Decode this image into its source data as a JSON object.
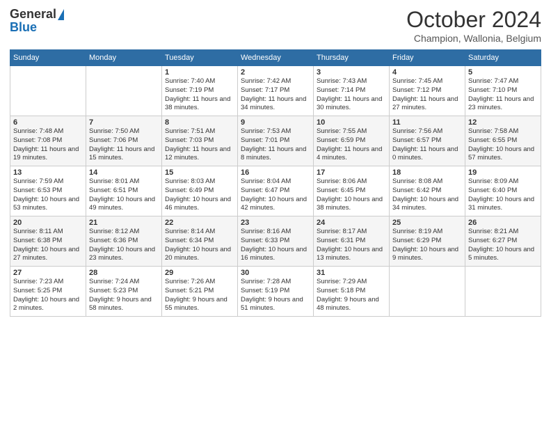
{
  "header": {
    "logo_general": "General",
    "logo_blue": "Blue",
    "title": "October 2024",
    "subtitle": "Champion, Wallonia, Belgium"
  },
  "days_of_week": [
    "Sunday",
    "Monday",
    "Tuesday",
    "Wednesday",
    "Thursday",
    "Friday",
    "Saturday"
  ],
  "weeks": [
    [
      {
        "day": "",
        "info": ""
      },
      {
        "day": "",
        "info": ""
      },
      {
        "day": "1",
        "info": "Sunrise: 7:40 AM\nSunset: 7:19 PM\nDaylight: 11 hours and 38 minutes."
      },
      {
        "day": "2",
        "info": "Sunrise: 7:42 AM\nSunset: 7:17 PM\nDaylight: 11 hours and 34 minutes."
      },
      {
        "day": "3",
        "info": "Sunrise: 7:43 AM\nSunset: 7:14 PM\nDaylight: 11 hours and 30 minutes."
      },
      {
        "day": "4",
        "info": "Sunrise: 7:45 AM\nSunset: 7:12 PM\nDaylight: 11 hours and 27 minutes."
      },
      {
        "day": "5",
        "info": "Sunrise: 7:47 AM\nSunset: 7:10 PM\nDaylight: 11 hours and 23 minutes."
      }
    ],
    [
      {
        "day": "6",
        "info": "Sunrise: 7:48 AM\nSunset: 7:08 PM\nDaylight: 11 hours and 19 minutes."
      },
      {
        "day": "7",
        "info": "Sunrise: 7:50 AM\nSunset: 7:06 PM\nDaylight: 11 hours and 15 minutes."
      },
      {
        "day": "8",
        "info": "Sunrise: 7:51 AM\nSunset: 7:03 PM\nDaylight: 11 hours and 12 minutes."
      },
      {
        "day": "9",
        "info": "Sunrise: 7:53 AM\nSunset: 7:01 PM\nDaylight: 11 hours and 8 minutes."
      },
      {
        "day": "10",
        "info": "Sunrise: 7:55 AM\nSunset: 6:59 PM\nDaylight: 11 hours and 4 minutes."
      },
      {
        "day": "11",
        "info": "Sunrise: 7:56 AM\nSunset: 6:57 PM\nDaylight: 11 hours and 0 minutes."
      },
      {
        "day": "12",
        "info": "Sunrise: 7:58 AM\nSunset: 6:55 PM\nDaylight: 10 hours and 57 minutes."
      }
    ],
    [
      {
        "day": "13",
        "info": "Sunrise: 7:59 AM\nSunset: 6:53 PM\nDaylight: 10 hours and 53 minutes."
      },
      {
        "day": "14",
        "info": "Sunrise: 8:01 AM\nSunset: 6:51 PM\nDaylight: 10 hours and 49 minutes."
      },
      {
        "day": "15",
        "info": "Sunrise: 8:03 AM\nSunset: 6:49 PM\nDaylight: 10 hours and 46 minutes."
      },
      {
        "day": "16",
        "info": "Sunrise: 8:04 AM\nSunset: 6:47 PM\nDaylight: 10 hours and 42 minutes."
      },
      {
        "day": "17",
        "info": "Sunrise: 8:06 AM\nSunset: 6:45 PM\nDaylight: 10 hours and 38 minutes."
      },
      {
        "day": "18",
        "info": "Sunrise: 8:08 AM\nSunset: 6:42 PM\nDaylight: 10 hours and 34 minutes."
      },
      {
        "day": "19",
        "info": "Sunrise: 8:09 AM\nSunset: 6:40 PM\nDaylight: 10 hours and 31 minutes."
      }
    ],
    [
      {
        "day": "20",
        "info": "Sunrise: 8:11 AM\nSunset: 6:38 PM\nDaylight: 10 hours and 27 minutes."
      },
      {
        "day": "21",
        "info": "Sunrise: 8:12 AM\nSunset: 6:36 PM\nDaylight: 10 hours and 23 minutes."
      },
      {
        "day": "22",
        "info": "Sunrise: 8:14 AM\nSunset: 6:34 PM\nDaylight: 10 hours and 20 minutes."
      },
      {
        "day": "23",
        "info": "Sunrise: 8:16 AM\nSunset: 6:33 PM\nDaylight: 10 hours and 16 minutes."
      },
      {
        "day": "24",
        "info": "Sunrise: 8:17 AM\nSunset: 6:31 PM\nDaylight: 10 hours and 13 minutes."
      },
      {
        "day": "25",
        "info": "Sunrise: 8:19 AM\nSunset: 6:29 PM\nDaylight: 10 hours and 9 minutes."
      },
      {
        "day": "26",
        "info": "Sunrise: 8:21 AM\nSunset: 6:27 PM\nDaylight: 10 hours and 5 minutes."
      }
    ],
    [
      {
        "day": "27",
        "info": "Sunrise: 7:23 AM\nSunset: 5:25 PM\nDaylight: 10 hours and 2 minutes."
      },
      {
        "day": "28",
        "info": "Sunrise: 7:24 AM\nSunset: 5:23 PM\nDaylight: 9 hours and 58 minutes."
      },
      {
        "day": "29",
        "info": "Sunrise: 7:26 AM\nSunset: 5:21 PM\nDaylight: 9 hours and 55 minutes."
      },
      {
        "day": "30",
        "info": "Sunrise: 7:28 AM\nSunset: 5:19 PM\nDaylight: 9 hours and 51 minutes."
      },
      {
        "day": "31",
        "info": "Sunrise: 7:29 AM\nSunset: 5:18 PM\nDaylight: 9 hours and 48 minutes."
      },
      {
        "day": "",
        "info": ""
      },
      {
        "day": "",
        "info": ""
      }
    ]
  ]
}
